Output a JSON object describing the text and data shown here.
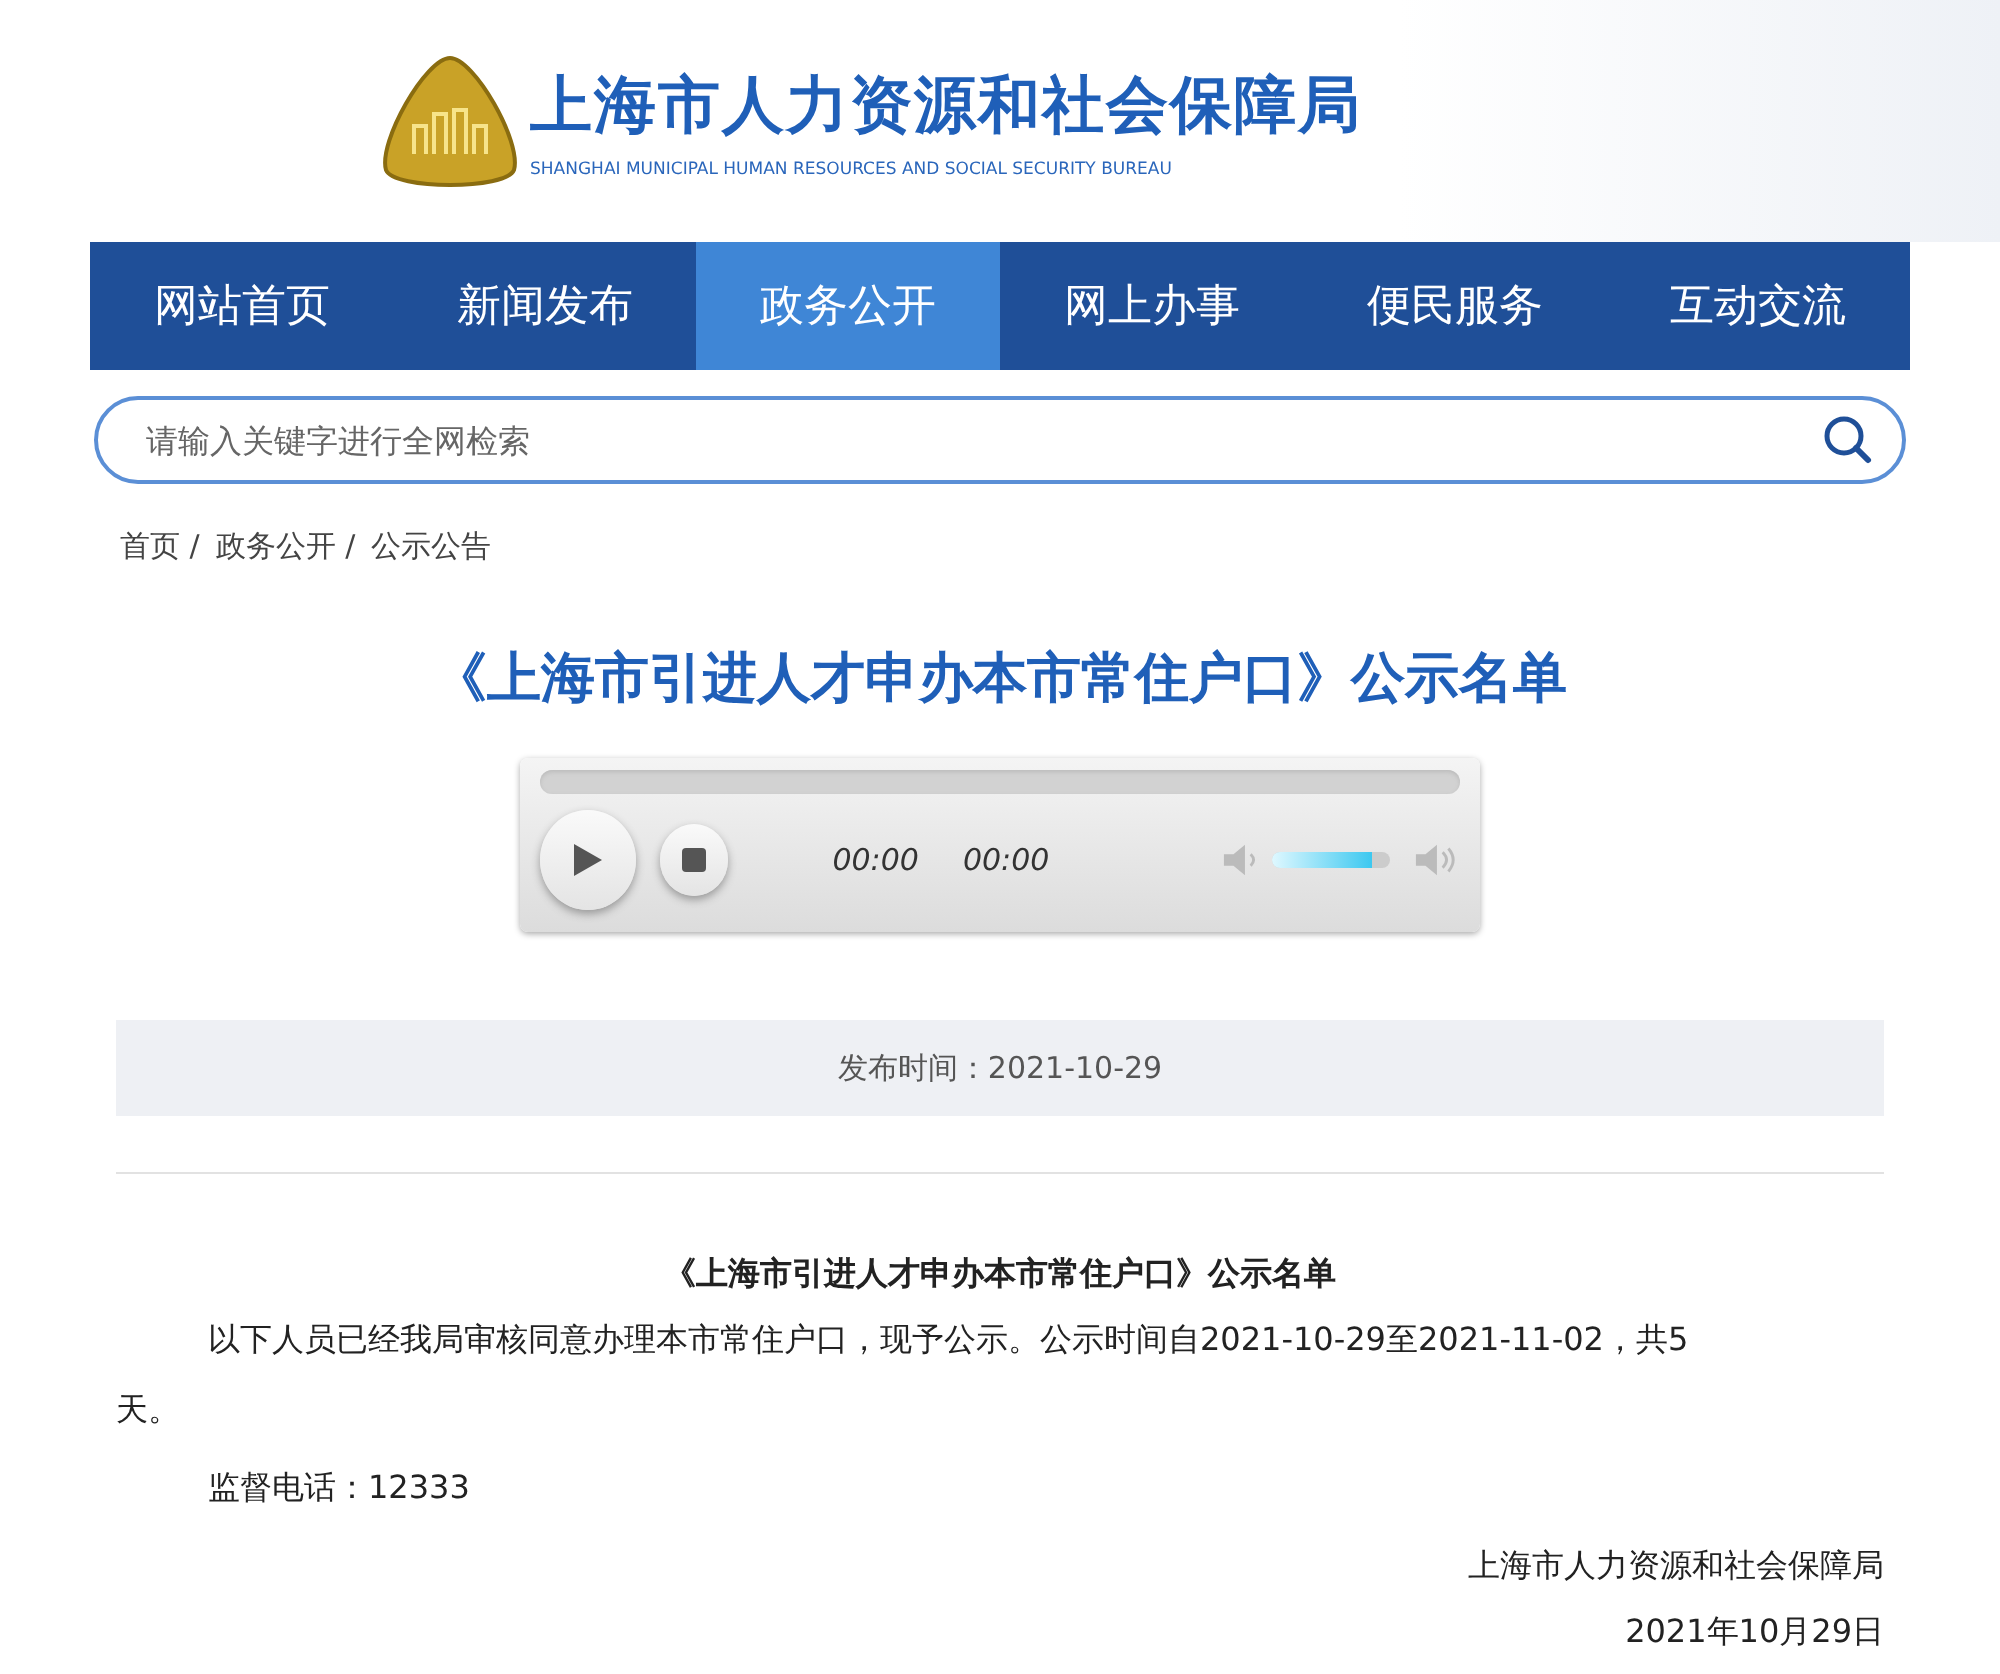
{
  "header": {
    "title": "上海市人力资源和社会保障局",
    "subtitle": "SHANGHAI MUNICIPAL HUMAN RESOURCES AND SOCIAL SECURITY BUREAU"
  },
  "nav": [
    {
      "label": "网站首页",
      "selected": false
    },
    {
      "label": "新闻发布",
      "selected": false
    },
    {
      "label": "政务公开",
      "selected": true
    },
    {
      "label": "网上办事",
      "selected": false
    },
    {
      "label": "便民服务",
      "selected": false
    },
    {
      "label": "互动交流",
      "selected": false
    }
  ],
  "search": {
    "placeholder": "请输入关键字进行全网检索"
  },
  "breadcrumb": [
    "首页 /",
    "政务公开 /",
    "公示公告"
  ],
  "title": "《上海市引进人才申办本市常住户口》公示名单",
  "player": {
    "elapsed": "00:00",
    "duration": "00:00",
    "volume": {
      "level": 0.85
    }
  },
  "publish": "发布时间：2021-10-29",
  "article": {
    "heading": "《上海市引进人才申办本市常住户口》公示名单",
    "paragraphs": [
      "以下人员已经我局审核同意办理本市常住户口，现予公示。公示时间自2021-10-29至2021-11-02，共5天。",
      "监督电话：12333"
    ],
    "signature": "上海市人力资源和社会保障局",
    "date": "2021年10月29日"
  }
}
